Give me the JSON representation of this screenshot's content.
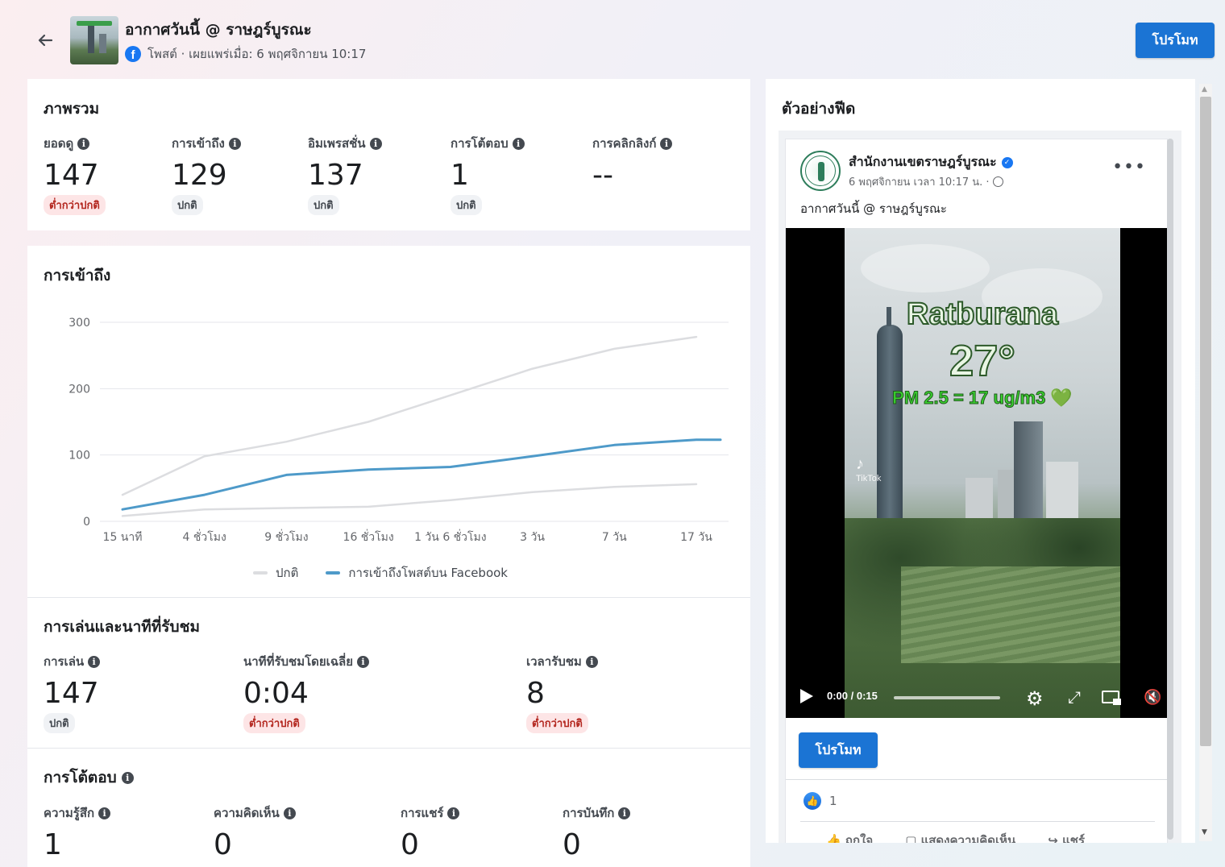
{
  "header": {
    "title": "อากาศวันนี้ @ ราษฎร์บูรณะ",
    "meta": "โพสต์ · เผยแพร่เมื่อ: 6 พฤศจิกายน 10:17",
    "promote_label": "โปรโมท"
  },
  "overview": {
    "title": "ภาพรวม",
    "metrics": [
      {
        "label": "ยอดดู",
        "value": "147",
        "status": "ต่ำกว่าปกติ"
      },
      {
        "label": "การเข้าถึง",
        "value": "129",
        "status": "ปกติ"
      },
      {
        "label": "อิมเพรสชั่น",
        "value": "137",
        "status": "ปกติ"
      },
      {
        "label": "การโต้ตอบ",
        "value": "1",
        "status": "ปกติ"
      },
      {
        "label": "การคลิกลิงก์",
        "value": "--",
        "status": ""
      }
    ]
  },
  "reach": {
    "title": "การเข้าถึง"
  },
  "chart_data": {
    "type": "line",
    "title": "การเข้าถึง",
    "x": [
      "15 นาที",
      "4 ชั่วโมง",
      "9 ชั่วโมง",
      "16 ชั่วโมง",
      "1 วัน 6 ชั่วโมง",
      "3 วัน",
      "7 วัน",
      "17 วัน"
    ],
    "yticks": [
      0,
      100,
      200,
      300
    ],
    "ylim": [
      0,
      300
    ],
    "grid": true,
    "legend_position": "bottom",
    "series": [
      {
        "name": "ปกติ",
        "color": "#dcdde0",
        "band": "upper",
        "values": [
          40,
          98,
          120,
          150,
          190,
          230,
          260,
          278
        ]
      },
      {
        "name": "ปกติ",
        "color": "#dcdde0",
        "band": "lower",
        "values": [
          8,
          18,
          20,
          22,
          32,
          44,
          52,
          56
        ]
      },
      {
        "name": "การเข้าถึงโพสต์บน Facebook",
        "color": "#4e9ac9",
        "values": [
          18,
          40,
          70,
          78,
          82,
          98,
          115,
          123
        ]
      }
    ],
    "legend": [
      "ปกติ",
      "การเข้าถึงโพสต์บน Facebook"
    ]
  },
  "plays": {
    "title": "การเล่นและนาทีที่รับชม",
    "metrics": [
      {
        "label": "การเล่น",
        "value": "147",
        "status": "ปกติ"
      },
      {
        "label": "นาทีที่รับชมโดยเฉลี่ย",
        "value": "0:04",
        "status": "ต่ำกว่าปกติ"
      },
      {
        "label": "เวลารับชม",
        "value": "8",
        "status": "ต่ำกว่าปกติ"
      }
    ]
  },
  "engagement": {
    "title": "การโต้ตอบ",
    "metrics": [
      {
        "label": "ความรู้สึก",
        "value": "1"
      },
      {
        "label": "ความคิดเห็น",
        "value": "0"
      },
      {
        "label": "การแชร์",
        "value": "0"
      },
      {
        "label": "การบันทึก",
        "value": "0"
      }
    ]
  },
  "preview": {
    "title": "ตัวอย่างฟีด",
    "page_name": "สำนักงานเขตราษฎร์บูรณะ",
    "post_time": "6 พฤศจิกายน เวลา 10:17 น. ·",
    "post_text": "อากาศวันนี้ @ ราษฎร์บูรณะ",
    "video": {
      "overlay_place": "Ratburana",
      "overlay_temp": "27°",
      "overlay_pm": "PM 2.5 = 17 ug/m3 💚",
      "watermark": "TikTok",
      "time": "0:00 / 0:15"
    },
    "promote_label": "โปรโมท",
    "like_count": "1",
    "actions": [
      "ถูกใจ",
      "แสดงความคิดเห็น",
      "แชร์"
    ]
  }
}
